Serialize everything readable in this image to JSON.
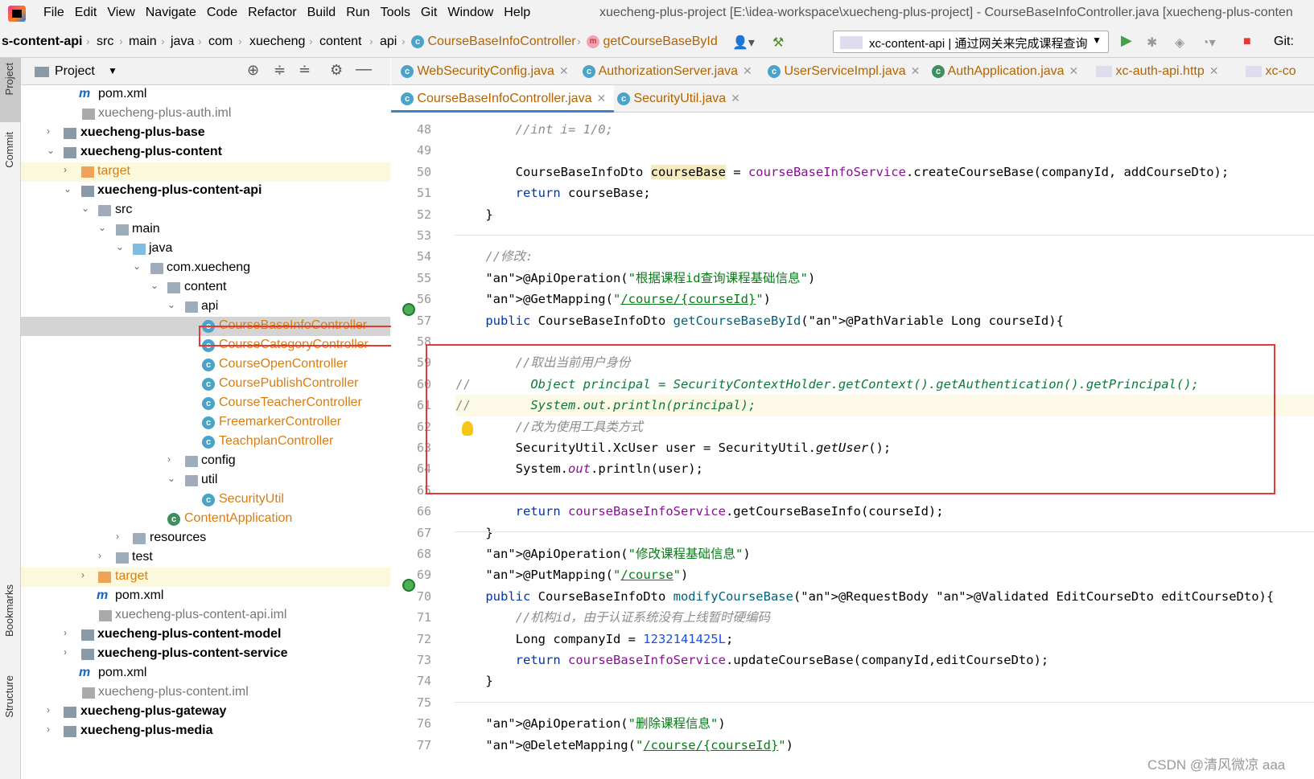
{
  "menubar": {
    "items": [
      "File",
      "Edit",
      "View",
      "Navigate",
      "Code",
      "Refactor",
      "Build",
      "Run",
      "Tools",
      "Git",
      "Window",
      "Help"
    ],
    "window_title": "xuecheng-plus-project [E:\\idea-workspace\\xuecheng-plus-project] - CourseBaseInfoController.java [xuecheng-plus-conten"
  },
  "navbar": {
    "crumbs": [
      "s-content-api",
      "src",
      "main",
      "java",
      "com",
      "xuecheng",
      "content",
      "api",
      "CourseBaseInfoController",
      "getCourseBaseById"
    ],
    "run_config": "xc-content-api | 通过网关来完成课程查询",
    "git_label": "Git:"
  },
  "leftstrip": {
    "project": "Project",
    "commit": "Commit",
    "bookmarks": "Bookmarks",
    "structure": "Structure"
  },
  "project_panel": {
    "title": "Project",
    "tree": [
      {
        "label": "pom.xml",
        "indent": 0
      },
      {
        "label": "xuecheng-plus-auth.iml",
        "indent": 0
      },
      {
        "label": "xuecheng-plus-base",
        "indent": 0
      },
      {
        "label": "xuecheng-plus-content",
        "indent": 0
      },
      {
        "label": "target",
        "indent": 1
      },
      {
        "label": "xuecheng-plus-content-api",
        "indent": 1
      },
      {
        "label": "src",
        "indent": 2
      },
      {
        "label": "main",
        "indent": 3
      },
      {
        "label": "java",
        "indent": 4
      },
      {
        "label": "com.xuecheng",
        "indent": 5
      },
      {
        "label": "content",
        "indent": 6
      },
      {
        "label": "api",
        "indent": 7
      },
      {
        "label": "CourseBaseInfoController",
        "indent": 8
      },
      {
        "label": "CourseCategoryController",
        "indent": 8
      },
      {
        "label": "CourseOpenController",
        "indent": 8
      },
      {
        "label": "CoursePublishController",
        "indent": 8
      },
      {
        "label": "CourseTeacherController",
        "indent": 8
      },
      {
        "label": "FreemarkerController",
        "indent": 8
      },
      {
        "label": "TeachplanController",
        "indent": 8
      },
      {
        "label": "config",
        "indent": 7
      },
      {
        "label": "util",
        "indent": 7
      },
      {
        "label": "SecurityUtil",
        "indent": 8
      },
      {
        "label": "ContentApplication",
        "indent": 6
      },
      {
        "label": "resources",
        "indent": 4
      },
      {
        "label": "test",
        "indent": 3
      },
      {
        "label": "target",
        "indent": 2
      },
      {
        "label": "pom.xml",
        "indent": 2
      },
      {
        "label": "xuecheng-plus-content-api.iml",
        "indent": 2
      },
      {
        "label": "xuecheng-plus-content-model",
        "indent": 1
      },
      {
        "label": "xuecheng-plus-content-service",
        "indent": 1
      },
      {
        "label": "pom.xml",
        "indent": 1
      },
      {
        "label": "xuecheng-plus-content.iml",
        "indent": 1
      },
      {
        "label": "xuecheng-plus-gateway",
        "indent": 0
      },
      {
        "label": "xuecheng-plus-media",
        "indent": 0
      }
    ]
  },
  "tabs_row1": [
    "WebSecurityConfig.java",
    "AuthorizationServer.java",
    "UserServiceImpl.java",
    "AuthApplication.java",
    "xc-auth-api.http",
    "xc-co"
  ],
  "tabs_row2": [
    "CourseBaseInfoController.java",
    "SecurityUtil.java"
  ],
  "editor": {
    "lines": [
      {
        "n": "48",
        "code": "        //int i= 1/0;"
      },
      {
        "n": "49",
        "code": ""
      },
      {
        "n": "50",
        "code": "        CourseBaseInfoDto courseBase = courseBaseInfoService.createCourseBase(companyId, addCourseDto);"
      },
      {
        "n": "51",
        "code": "        return courseBase;"
      },
      {
        "n": "52",
        "code": "    }"
      },
      {
        "n": "53",
        "code": ""
      },
      {
        "n": "54",
        "code": "    //修改:"
      },
      {
        "n": "55",
        "code": "    @ApiOperation(\"根据课程id查询课程基础信息\")"
      },
      {
        "n": "56",
        "code": "    @GetMapping(\"/course/{courseId}\")"
      },
      {
        "n": "57",
        "code": "    public CourseBaseInfoDto getCourseBaseById(@PathVariable Long courseId){"
      },
      {
        "n": "58",
        "code": ""
      },
      {
        "n": "59",
        "code": "        //取出当前用户身份"
      },
      {
        "n": "60",
        "code": "//        Object principal = SecurityContextHolder.getContext().getAuthentication().getPrincipal();"
      },
      {
        "n": "61",
        "code": "//        System.out.println(principal);"
      },
      {
        "n": "62",
        "code": "        //改为使用工具类方式"
      },
      {
        "n": "63",
        "code": "        SecurityUtil.XcUser user = SecurityUtil.getUser();"
      },
      {
        "n": "64",
        "code": "        System.out.println(user);"
      },
      {
        "n": "65",
        "code": ""
      },
      {
        "n": "66",
        "code": "        return courseBaseInfoService.getCourseBaseInfo(courseId);"
      },
      {
        "n": "67",
        "code": "    }"
      },
      {
        "n": "68",
        "code": "    @ApiOperation(\"修改课程基础信息\")"
      },
      {
        "n": "69",
        "code": "    @PutMapping(\"/course\")"
      },
      {
        "n": "70",
        "code": "    public CourseBaseInfoDto modifyCourseBase(@RequestBody @Validated EditCourseDto editCourseDto){"
      },
      {
        "n": "71",
        "code": "        //机构id，由于认证系统没有上线暂时硬编码"
      },
      {
        "n": "72",
        "code": "        Long companyId = 1232141425L;"
      },
      {
        "n": "73",
        "code": "        return courseBaseInfoService.updateCourseBase(companyId,editCourseDto);"
      },
      {
        "n": "74",
        "code": "    }"
      },
      {
        "n": "75",
        "code": ""
      },
      {
        "n": "76",
        "code": "    @ApiOperation(\"删除课程信息\")"
      },
      {
        "n": "77",
        "code": "    @DeleteMapping(\"/course/{courseId}\")"
      }
    ]
  },
  "watermark": "CSDN @清风微凉 aaa",
  "colors": {
    "highlight_box": "#e53935",
    "accent": "#4083c9"
  }
}
